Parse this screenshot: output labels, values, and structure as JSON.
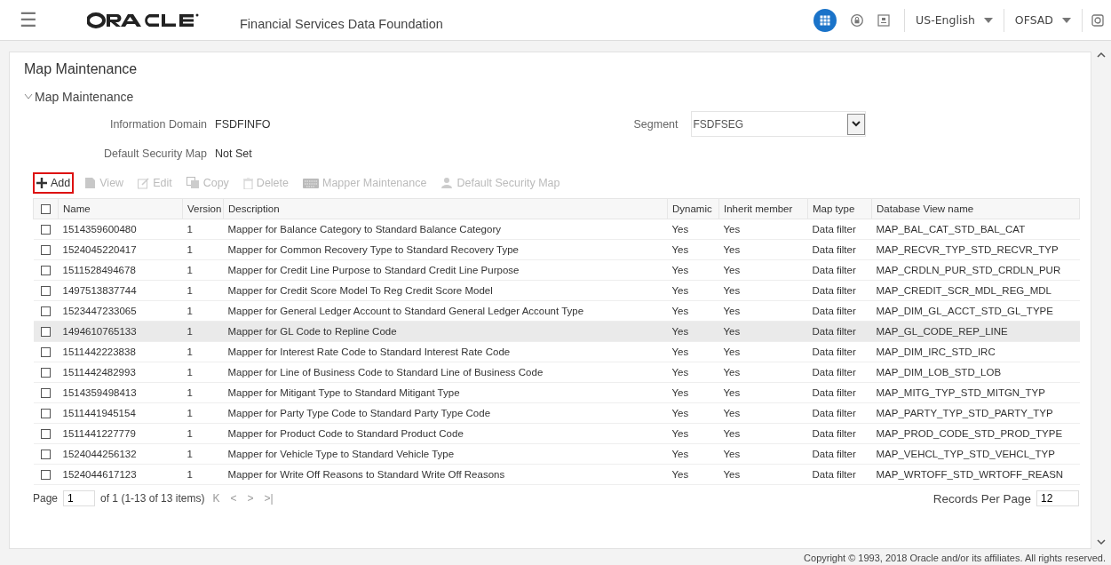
{
  "header": {
    "menu_icon": "☰",
    "product": "Financial Services Data Foundation",
    "language": "US-English",
    "user": "OFSAD"
  },
  "page": {
    "title": "Map Maintenance",
    "section": {
      "label": "Map Maintenance",
      "expanded": true
    },
    "information_domain": {
      "label": "Information Domain",
      "value": "FSDFINFO"
    },
    "segment": {
      "label": "Segment",
      "value": "FSDFSEG"
    },
    "default_security_map": {
      "label": "Default Security Map",
      "value": "Not Set"
    }
  },
  "toolbar": [
    {
      "kind": "add",
      "label": "Add",
      "disabled": false,
      "highlighted": true
    },
    {
      "kind": "view",
      "label": "View",
      "disabled": true,
      "highlighted": false
    },
    {
      "kind": "edit",
      "label": "Edit",
      "disabled": true,
      "highlighted": false
    },
    {
      "kind": "copy",
      "label": "Copy",
      "disabled": true,
      "highlighted": false
    },
    {
      "kind": "delete",
      "label": "Delete",
      "disabled": true,
      "highlighted": false
    },
    {
      "kind": "mapper",
      "label": "Mapper Maintenance",
      "disabled": true,
      "highlighted": false
    },
    {
      "kind": "security",
      "label": "Default Security Map",
      "disabled": true,
      "highlighted": false
    }
  ],
  "table": {
    "select_all": {
      "checked": false
    },
    "columns": [
      "Name",
      "Version",
      "Description",
      "Dynamic",
      "Inherit member",
      "Map type",
      "Database View name"
    ],
    "rows": [
      {
        "cells": [
          "1514359600480",
          "1",
          "Mapper for Balance Category to Standard Balance Category",
          "Yes",
          "Yes",
          "Data filter",
          "MAP_BAL_CAT_STD_BAL_CAT"
        ],
        "checked": false,
        "selected": false
      },
      {
        "cells": [
          "1524045220417",
          "1",
          "Mapper for Common Recovery Type to Standard Recovery Type",
          "Yes",
          "Yes",
          "Data filter",
          "MAP_RECVR_TYP_STD_RECVR_TYP"
        ],
        "checked": false,
        "selected": false
      },
      {
        "cells": [
          "1511528494678",
          "1",
          "Mapper for Credit Line Purpose to Standard Credit Line Purpose",
          "Yes",
          "Yes",
          "Data filter",
          "MAP_CRDLN_PUR_STD_CRDLN_PUR"
        ],
        "checked": false,
        "selected": false
      },
      {
        "cells": [
          "1497513837744",
          "1",
          "Mapper for Credit Score Model To Reg Credit Score Model",
          "Yes",
          "Yes",
          "Data filter",
          "MAP_CREDIT_SCR_MDL_REG_MDL"
        ],
        "checked": false,
        "selected": false
      },
      {
        "cells": [
          "1523447233065",
          "1",
          "Mapper for General Ledger Account to Standard General Ledger Account Type",
          "Yes",
          "Yes",
          "Data filter",
          "MAP_DIM_GL_ACCT_STD_GL_TYPE"
        ],
        "checked": false,
        "selected": false
      },
      {
        "cells": [
          "1494610765133",
          "1",
          "Mapper for GL Code to Repline Code",
          "Yes",
          "Yes",
          "Data filter",
          "MAP_GL_CODE_REP_LINE"
        ],
        "checked": false,
        "selected": true
      },
      {
        "cells": [
          "1511442223838",
          "1",
          "Mapper for Interest Rate Code to Standard Interest Rate Code",
          "Yes",
          "Yes",
          "Data filter",
          "MAP_DIM_IRC_STD_IRC"
        ],
        "checked": false,
        "selected": false
      },
      {
        "cells": [
          "1511442482993",
          "1",
          "Mapper for Line of Business Code to Standard Line of Business Code",
          "Yes",
          "Yes",
          "Data filter",
          "MAP_DIM_LOB_STD_LOB"
        ],
        "checked": false,
        "selected": false
      },
      {
        "cells": [
          "1514359498413",
          "1",
          "Mapper for Mitigant Type to Standard Mitigant Type",
          "Yes",
          "Yes",
          "Data filter",
          "MAP_MITG_TYP_STD_MITGN_TYP"
        ],
        "checked": false,
        "selected": false
      },
      {
        "cells": [
          "1511441945154",
          "1",
          "Mapper for Party Type Code to Standard Party Type Code",
          "Yes",
          "Yes",
          "Data filter",
          "MAP_PARTY_TYP_STD_PARTY_TYP"
        ],
        "checked": false,
        "selected": false
      },
      {
        "cells": [
          "1511441227779",
          "1",
          "Mapper for Product Code to Standard Product Code",
          "Yes",
          "Yes",
          "Data filter",
          "MAP_PROD_CODE_STD_PROD_TYPE"
        ],
        "checked": false,
        "selected": false
      },
      {
        "cells": [
          "1524044256132",
          "1",
          "Mapper for Vehicle Type to Standard Vehicle Type",
          "Yes",
          "Yes",
          "Data filter",
          "MAP_VEHCL_TYP_STD_VEHCL_TYP"
        ],
        "checked": false,
        "selected": false
      },
      {
        "cells": [
          "1524044617123",
          "1",
          "Mapper for Write Off Reasons to Standard Write Off Reasons",
          "Yes",
          "Yes",
          "Data filter",
          "MAP_WRTOFF_STD_WRTOFF_REASN"
        ],
        "checked": false,
        "selected": false
      }
    ]
  },
  "pagination": {
    "page_label": "Page",
    "page": "1",
    "of_text": "of 1 (1-13 of 13 items)",
    "nav": [
      "K",
      "<",
      ">",
      ">|"
    ],
    "records_label": "Records Per Page",
    "records": "12"
  },
  "footer": {
    "copyright": "Copyright © 1993, 2018 Oracle and/or its affiliates. All rights reserved."
  }
}
